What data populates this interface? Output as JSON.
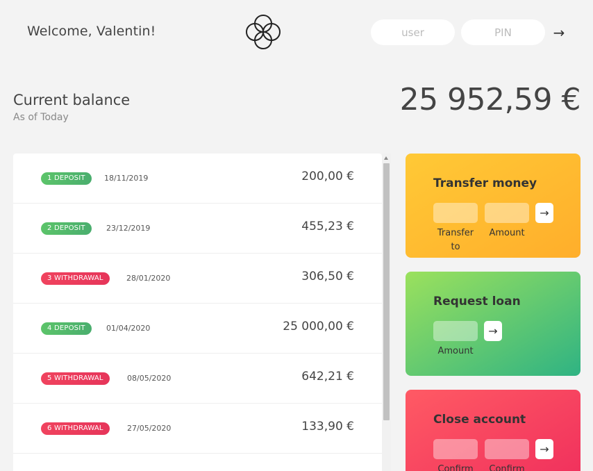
{
  "nav": {
    "welcome": "Welcome, Valentin!",
    "user_placeholder": "user",
    "pin_placeholder": "PIN",
    "login_arrow": "→"
  },
  "balance": {
    "label": "Current balance",
    "date": "As of Today",
    "value": "25 952,59 €"
  },
  "movements": [
    {
      "type_label": "1 DEPOSIT",
      "kind": "deposit",
      "date": "18/11/2019",
      "value": "200,00 €"
    },
    {
      "type_label": "2 DEPOSIT",
      "kind": "deposit",
      "date": "23/12/2019",
      "value": "455,23 €"
    },
    {
      "type_label": "3 WITHDRAWAL",
      "kind": "withdrawal",
      "date": "28/01/2020",
      "value": "306,50 €"
    },
    {
      "type_label": "4 DEPOSIT",
      "kind": "deposit",
      "date": "01/04/2020",
      "value": "25 000,00 €"
    },
    {
      "type_label": "5 WITHDRAWAL",
      "kind": "withdrawal",
      "date": "08/05/2020",
      "value": "642,21 €"
    },
    {
      "type_label": "6 WITHDRAWAL",
      "kind": "withdrawal",
      "date": "27/05/2020",
      "value": "133,90 €"
    }
  ],
  "operations": {
    "transfer": {
      "title": "Transfer money",
      "to_label": "Transfer to",
      "amount_label": "Amount",
      "button": "→"
    },
    "loan": {
      "title": "Request loan",
      "amount_label": "Amount",
      "button": "→"
    },
    "close": {
      "title": "Close account",
      "user_label": "Confirm user",
      "pin_label": "Confirm PIN",
      "button": "→"
    }
  },
  "colors": {
    "background": "#f3f3f3",
    "deposit": "#5cc46a",
    "withdrawal": "#f0435e",
    "transfer": "#ffbb33",
    "loan": "#66c973",
    "close": "#f7455e"
  }
}
